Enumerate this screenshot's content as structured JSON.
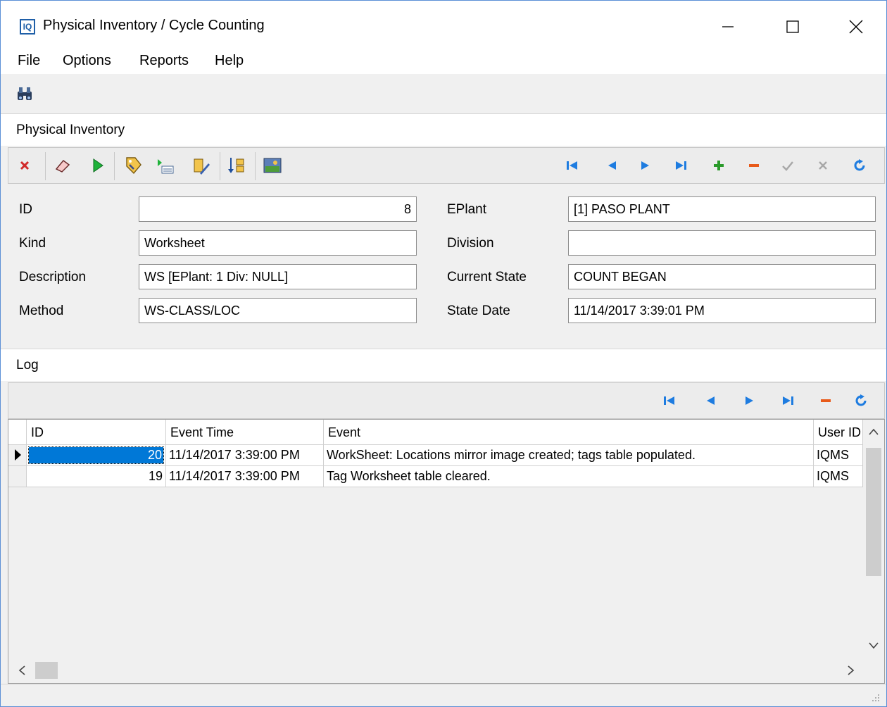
{
  "window": {
    "app_icon_text": "IQ",
    "title": "Physical Inventory / Cycle Counting",
    "minimize_glyph": "—",
    "maximize_glyph": "☐",
    "close_glyph": "✕"
  },
  "menu": [
    "File",
    "Options",
    "Reports",
    "Help"
  ],
  "toolbar": {
    "icons": [
      "binoculars-icon"
    ]
  },
  "physical_inventory": {
    "header": "Physical Inventory",
    "toolbar_icons": [
      "delete-icon",
      "eraser-icon",
      "play-icon",
      "tag-icon",
      "run-list-icon",
      "edit-icon",
      "sort-icon",
      "picture-icon"
    ],
    "nav_icons": [
      "first-record-icon",
      "prior-record-icon",
      "next-record-icon",
      "last-record-icon",
      "insert-icon",
      "delete-record-icon",
      "post-icon",
      "cancel-icon",
      "refresh-icon"
    ],
    "fields": {
      "id_label": "ID",
      "id_value": "8",
      "kind_label": "Kind",
      "kind_value": "Worksheet",
      "description_label": "Description",
      "description_value": "WS [EPlant: 1 Div: NULL]",
      "method_label": "Method",
      "method_value": "WS-CLASS/LOC",
      "eplant_label": "EPlant",
      "eplant_value": "[1] PASO PLANT",
      "division_label": "Division",
      "division_value": "",
      "current_state_label": "Current State",
      "current_state_value": "COUNT BEGAN",
      "state_date_label": "State Date",
      "state_date_value": "11/14/2017 3:39:01 PM"
    }
  },
  "log": {
    "header": "Log",
    "nav_icons": [
      "first-record-icon",
      "prior-record-icon",
      "next-record-icon",
      "last-record-icon",
      "delete-record-icon",
      "refresh-icon"
    ],
    "columns": [
      "ID",
      "Event Time",
      "Event",
      "User ID"
    ],
    "rows": [
      {
        "id": "20",
        "event_time": "11/14/2017 3:39:00 PM",
        "event": "WorkSheet: Locations mirror image created; tags table populated.",
        "user": "IQMS",
        "selected": true
      },
      {
        "id": "19",
        "event_time": "11/14/2017 3:39:00 PM",
        "event": "Tag Worksheet table cleared.",
        "user": "IQMS",
        "selected": false
      }
    ]
  }
}
